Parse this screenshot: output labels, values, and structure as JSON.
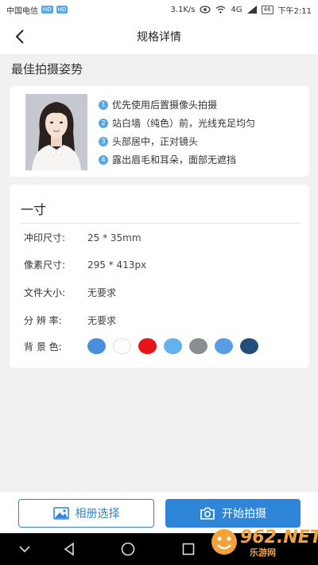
{
  "status_bar": {
    "carrier": "中国电信",
    "hd1": "HD",
    "hd2": "HD",
    "speed": "3.1K/s",
    "network": "4G",
    "battery": "46",
    "time": "下午2:11"
  },
  "nav": {
    "title": "规格详情"
  },
  "pose_section": {
    "heading": "最佳拍摄姿势",
    "tips": [
      {
        "num": "1",
        "text": "优先使用后置摄像头拍摄"
      },
      {
        "num": "2",
        "text": "站白墙（纯色）前，光线充足均匀"
      },
      {
        "num": "3",
        "text": "头部居中，正对镜头"
      },
      {
        "num": "4",
        "text": "露出眉毛和耳朵，面部无遮挡"
      }
    ]
  },
  "spec": {
    "title": "一寸",
    "print_label": "冲印尺寸:",
    "print_value": "25 * 35mm",
    "pixel_label": "像素尺寸:",
    "pixel_value": "295 * 413px",
    "filesize_label": "文件大小:",
    "filesize_value": "无要求",
    "resolution_label": "分 辨 率:",
    "resolution_value": "无要求",
    "bg_label": "背 景 色:",
    "bg_colors": [
      "#4a8fdb",
      "#ffffff",
      "#e8141a",
      "#63b2ee",
      "#8a8d92",
      "#5a9be6",
      "#264e7a"
    ]
  },
  "buttons": {
    "album": "相册选择",
    "start": "开始拍摄"
  },
  "watermark": {
    "text": "962.NET",
    "sub": "乐游网"
  }
}
